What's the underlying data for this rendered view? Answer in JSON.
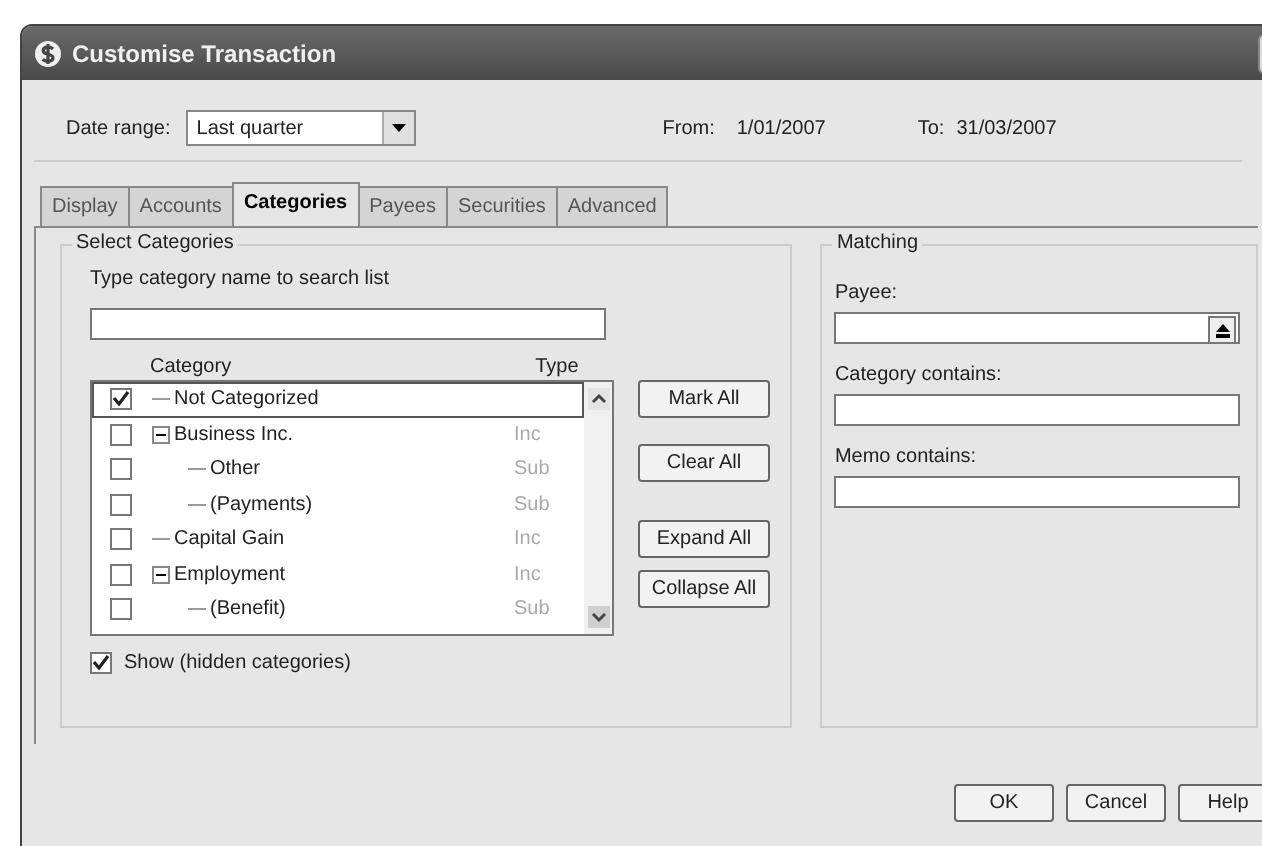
{
  "window": {
    "title": "Customise Transaction"
  },
  "date_range": {
    "label": "Date range:",
    "value": "Last quarter",
    "from_label": "From:",
    "from": "1/01/2007",
    "to_label": "To:",
    "to": "31/03/2007"
  },
  "tabs": [
    {
      "label": "Display",
      "selected": false
    },
    {
      "label": "Accounts",
      "selected": false
    },
    {
      "label": "Categories",
      "selected": true
    },
    {
      "label": "Payees",
      "selected": false
    },
    {
      "label": "Securities",
      "selected": false
    },
    {
      "label": "Advanced",
      "selected": false
    }
  ],
  "select_categories": {
    "title": "Select Categories",
    "search_label": "Type category name to search list",
    "columns": [
      "Category",
      "Type"
    ],
    "tree": [
      {
        "name": "Not Categorized",
        "checked": true,
        "selected": true
      },
      {
        "name": "Business Inc.",
        "type": "Inc",
        "checked": false,
        "selected": false,
        "expanded": true,
        "children": [
          {
            "name": "Other",
            "type": "Sub",
            "checked": false,
            "selected": false
          },
          {
            "name": "(Payments)",
            "type": "Sub",
            "checked": false,
            "selected": false
          }
        ]
      },
      {
        "name": "Capital Gain",
        "type": "Inc",
        "checked": false,
        "selected": false
      },
      {
        "name": "Employment",
        "type": "Inc",
        "checked": false,
        "selected": false,
        "expanded": true,
        "children": [
          {
            "name": "(Benefit)",
            "type": "Sub",
            "checked": false,
            "selected": false
          }
        ]
      }
    ],
    "show_hidden": {
      "label": "Show (hidden categories)",
      "checked": true
    },
    "buttons": [
      "Mark All",
      "Clear All",
      "Expand All",
      "Collapse All"
    ]
  },
  "matching": {
    "title": "Matching",
    "payee_label": "Payee:",
    "category_label": "Category contains:",
    "memo_label": "Memo contains:"
  },
  "footer_buttons": [
    "OK",
    "Cancel",
    "Help"
  ]
}
